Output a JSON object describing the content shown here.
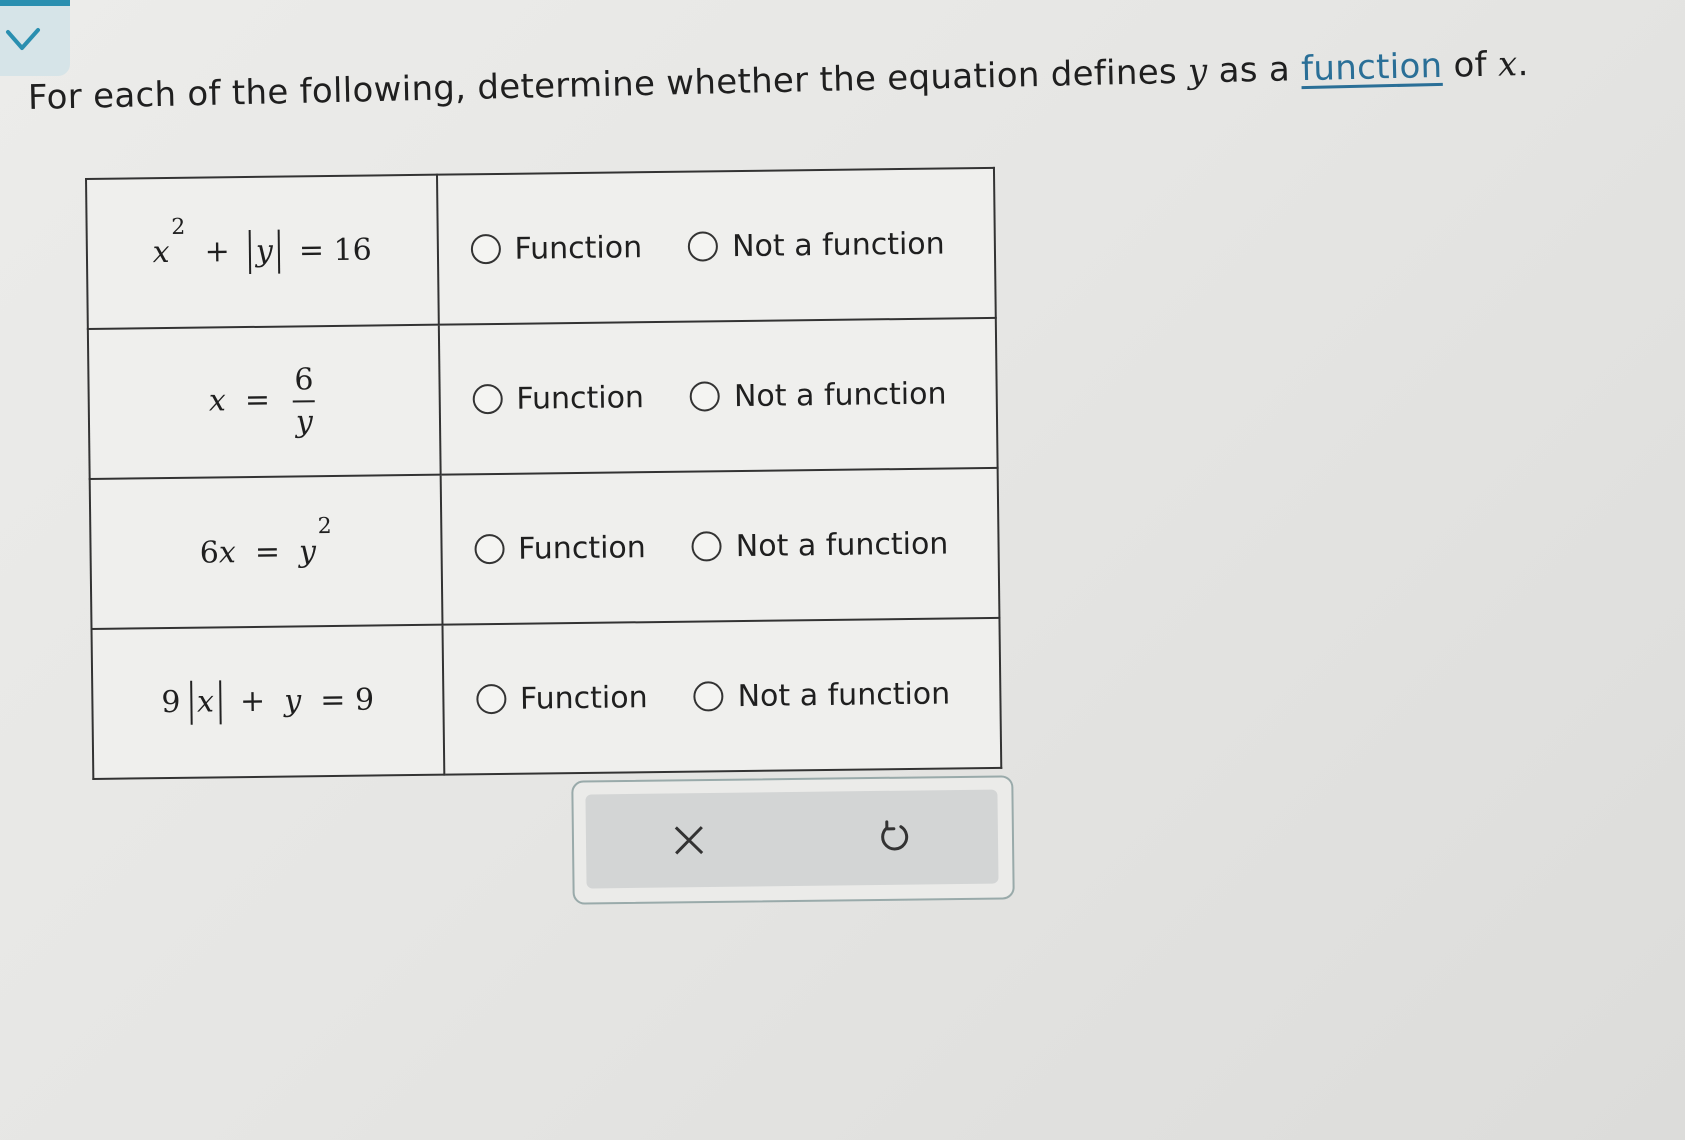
{
  "prompt": {
    "text_before": "For each of the following, determine whether the equation defines ",
    "var_y": "y",
    "text_mid": " as a ",
    "link": "function",
    "text_after": " of ",
    "var_x": "x",
    "period": "."
  },
  "rows": [
    {
      "equation": "x^2 + |y| = 16",
      "option_a": "Function",
      "option_b": "Not a function"
    },
    {
      "equation": "x = 6/y",
      "option_a": "Function",
      "option_b": "Not a function"
    },
    {
      "equation": "6x = y^2",
      "option_a": "Function",
      "option_b": "Not a function"
    },
    {
      "equation": "9|x| + y = 9",
      "option_a": "Function",
      "option_b": "Not a function"
    }
  ],
  "eq_parts": {
    "r0": {
      "x": "x",
      "exp": "2",
      "plus": "+",
      "y": "y",
      "rhs": "= 16"
    },
    "r1": {
      "x": "x",
      "eq": "=",
      "num": "6",
      "den": "y"
    },
    "r2": {
      "lhs": "6",
      "x": "x",
      "eq": "=",
      "y": "y",
      "exp": "2"
    },
    "r3": {
      "coef": "9",
      "x": "x",
      "plus": "+",
      "y": "y",
      "rhs": "= 9"
    }
  },
  "buttons": {
    "clear_icon": "close-icon",
    "undo_icon": "undo-icon"
  },
  "colors": {
    "accent": "#2a8fb0",
    "link": "#2a6f97"
  }
}
